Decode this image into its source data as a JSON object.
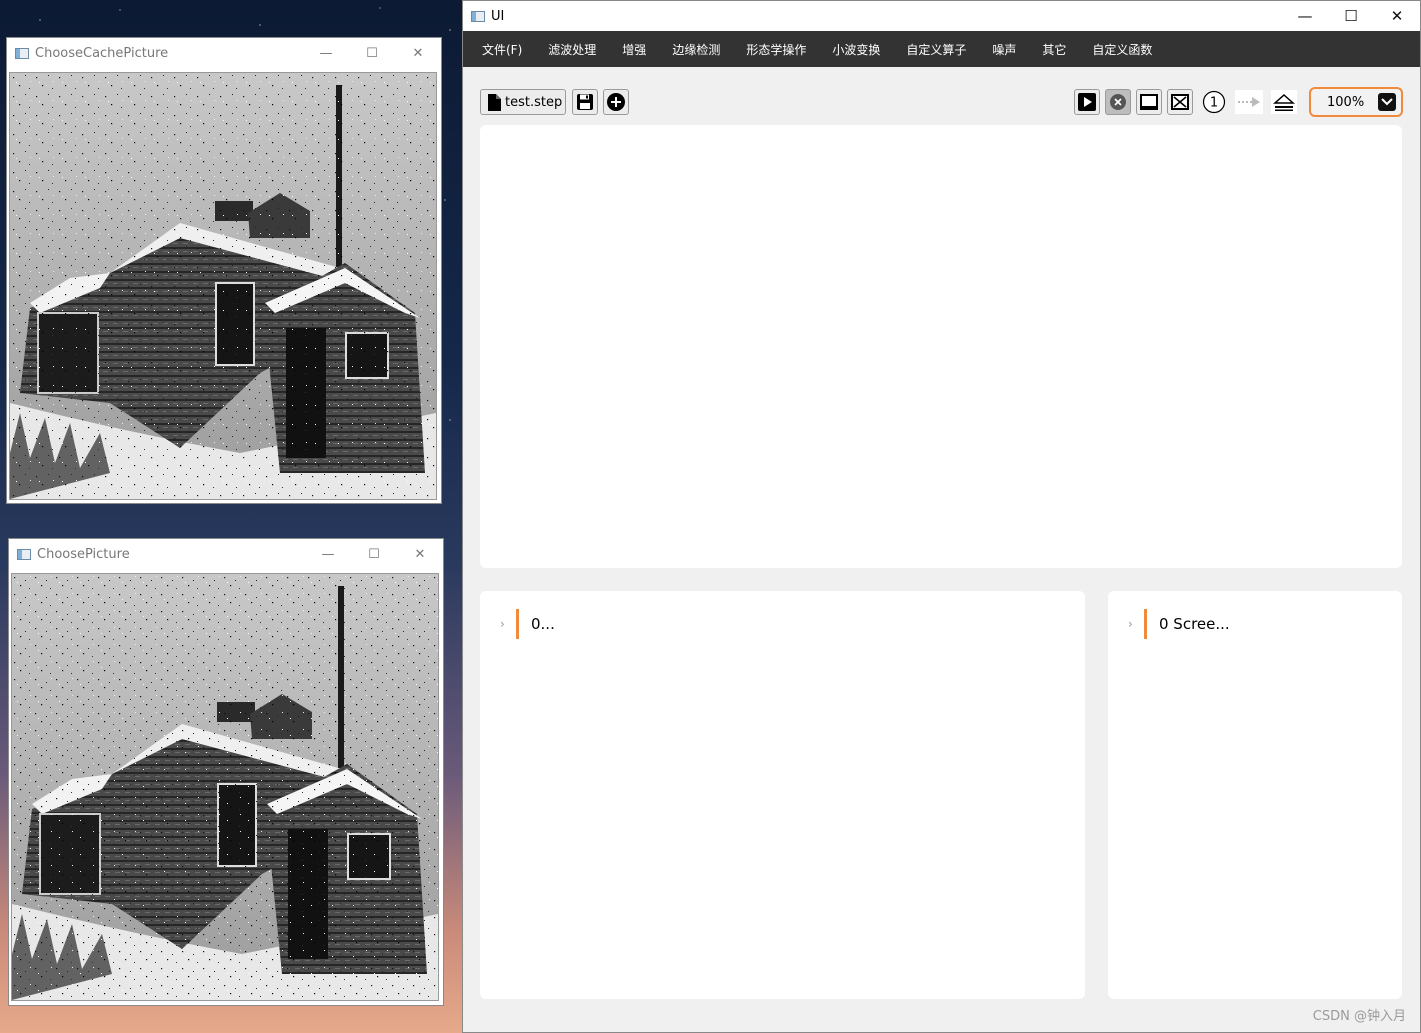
{
  "cache_window": {
    "title": "ChooseCachePicture"
  },
  "picture_window": {
    "title": "ChoosePicture"
  },
  "main_window": {
    "title": "UI",
    "menu": [
      "文件(F)",
      "滤波处理",
      "增强",
      "边缘检测",
      "形态学操作",
      "小波变换",
      "自定义算子",
      "噪声",
      "其它",
      "自定义函数"
    ],
    "toolbar": {
      "file_label": "test.step",
      "zoom_value": "100%"
    },
    "left_section_label": "0...",
    "right_section_label": "0 Scree..."
  },
  "window_controls": {
    "minimize": "—",
    "maximize": "☐",
    "close": "✕"
  },
  "watermark": "CSDN @钟入月",
  "colors": {
    "menubar": "#333333",
    "accent": "#f08a3c",
    "panel": "#ffffff",
    "background": "#f0f0f0"
  },
  "icons": [
    "document-icon",
    "save-icon",
    "add-icon",
    "play-icon",
    "stop-icon",
    "screen-icon",
    "clear-screen-icon",
    "step-one-icon",
    "arrow-right-icon",
    "eject-icon",
    "chevron-down-icon"
  ]
}
